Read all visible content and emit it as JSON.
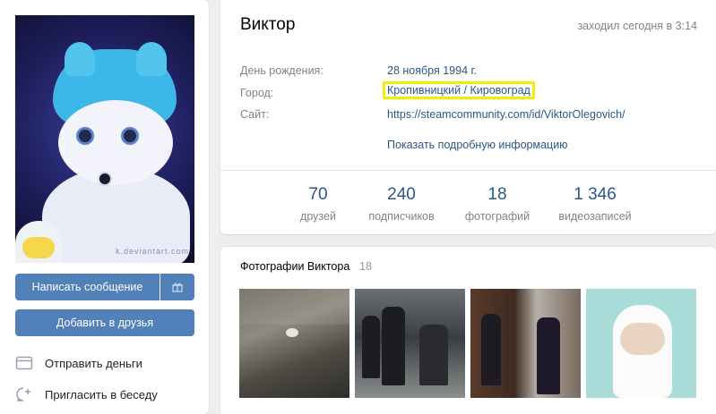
{
  "profile": {
    "watermark": "k.deviantart.com"
  },
  "actions": {
    "message_label": "Написать сообщение",
    "add_friend_label": "Добавить в друзья",
    "send_money_label": "Отправить деньги",
    "invite_chat_label": "Пригласить в беседу"
  },
  "info": {
    "name": "Виктор",
    "last_seen": "заходил сегодня в 3:14",
    "birthday_label": "День рождения:",
    "birthday_value": "28 ноября 1994 г.",
    "city_label": "Город:",
    "city_value": "Кропивницкий / Кировоград",
    "site_label": "Сайт:",
    "site_value": "https://steamcommunity.com/id/ViktorOlegovich/",
    "more_link": "Показать подробную информацию",
    "highlight_color": "#f2ee00"
  },
  "counters": [
    {
      "num": "70",
      "label": "друзей"
    },
    {
      "num": "240",
      "label": "подписчиков"
    },
    {
      "num": "18",
      "label": "фотографий"
    },
    {
      "num": "1 346",
      "label": "видеозаписей"
    }
  ],
  "photos": {
    "title": "Фотографии Виктора",
    "count": "18"
  },
  "colors": {
    "accent": "#5181b8",
    "link": "#2a5885",
    "muted": "#828282",
    "background": "#edeef0"
  }
}
